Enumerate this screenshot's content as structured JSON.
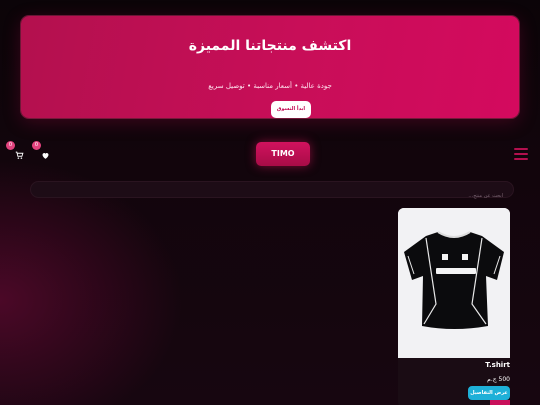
{
  "hero": {
    "title": "اكتشف منتجاتنا المميزة",
    "subtitle": "جودة عالية • أسعار مناسبة • توصيل سريع",
    "cta_label": "ابدأ التسوق"
  },
  "header": {
    "cart_count": "0",
    "wishlist_count": "0",
    "logo_label": "TIMO"
  },
  "search": {
    "placeholder": "ابحث عن منتج..."
  },
  "products": [
    {
      "name": "T.shirt",
      "price": "500 ج.م",
      "details_label": "عرض التفاصيل"
    }
  ],
  "colors": {
    "accent": "#c80e58",
    "details_button": "#1eb0d8"
  }
}
